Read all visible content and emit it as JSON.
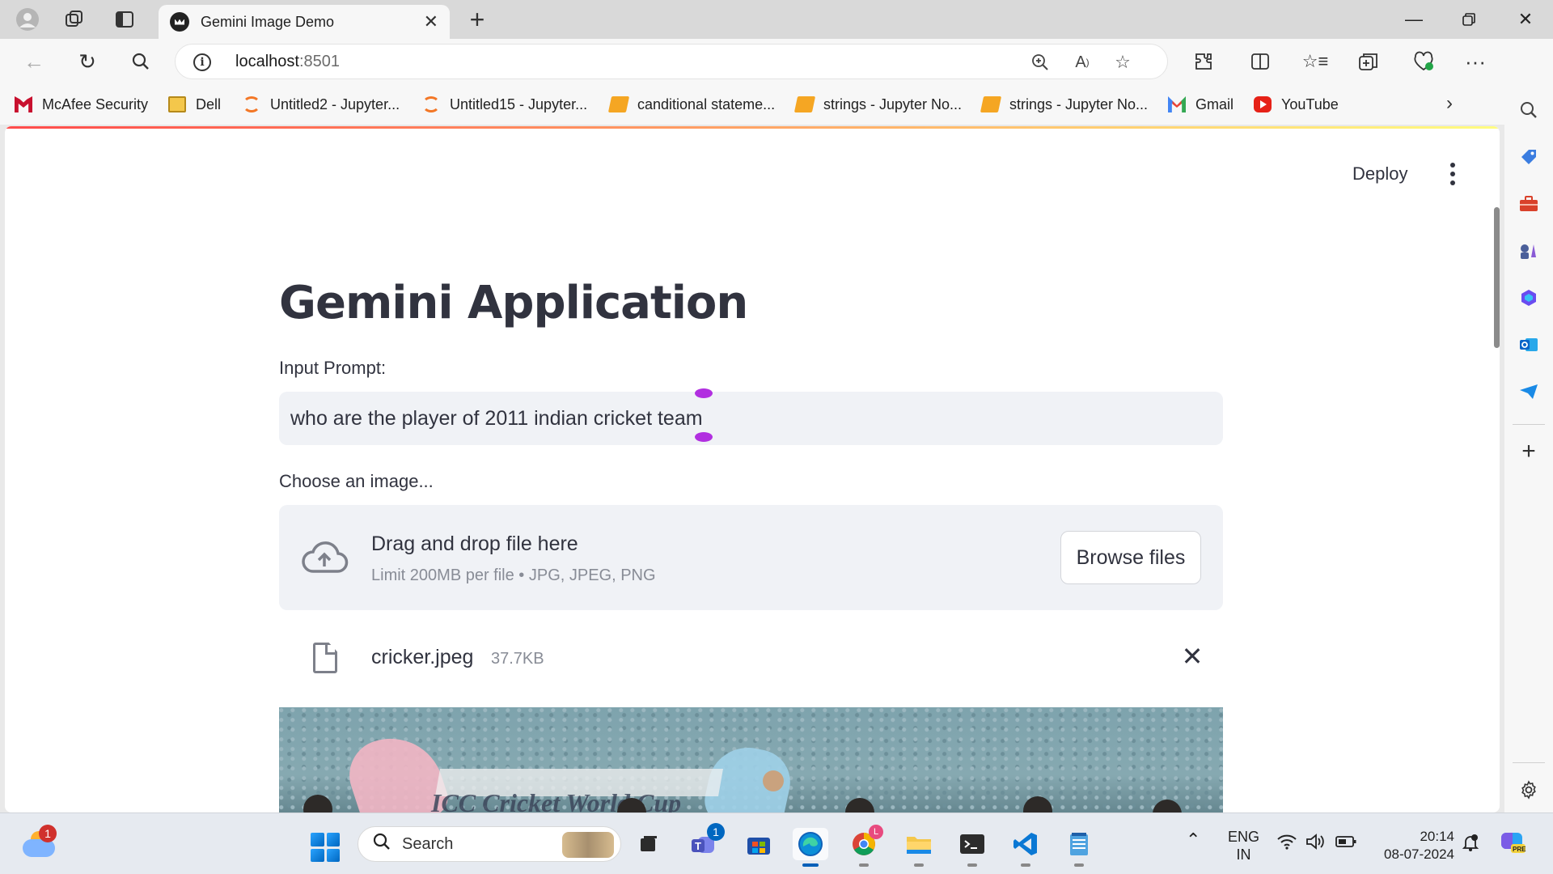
{
  "browser": {
    "tab_title": "Gemini Image Demo",
    "url_host": "localhost",
    "url_port": ":8501"
  },
  "bookmarks": [
    {
      "label": "McAfee Security",
      "icon": "mcafee-icon"
    },
    {
      "label": "Dell",
      "icon": "folder-icon"
    },
    {
      "label": "Untitled2 - Jupyter...",
      "icon": "jupyter-icon"
    },
    {
      "label": "Untitled15 - Jupyter...",
      "icon": "jupyter-icon"
    },
    {
      "label": "canditional stateme...",
      "icon": "notebook-icon"
    },
    {
      "label": "strings - Jupyter No...",
      "icon": "notebook-icon"
    },
    {
      "label": "strings - Jupyter No...",
      "icon": "notebook-icon"
    },
    {
      "label": "Gmail",
      "icon": "gmail-icon"
    },
    {
      "label": "YouTube",
      "icon": "youtube-icon"
    }
  ],
  "app": {
    "deploy_label": "Deploy",
    "title": "Gemini Application",
    "prompt_label": "Input Prompt:",
    "prompt_value": "who are the player of 2011 indian cricket team",
    "image_label": "Choose an image...",
    "dropzone_title": "Drag and drop file here",
    "dropzone_limit": "Limit 200MB per file • JPG, JPEG, PNG",
    "browse_label": "Browse files",
    "file_name": "cricker.jpeg",
    "file_size": "37.7KB",
    "preview_caption_text": "ICC Cricket World Cup"
  },
  "taskbar": {
    "weather_badge": "1",
    "search_label": "Search",
    "teams_badge": "1",
    "lang_top": "ENG",
    "lang_bottom": "IN",
    "time": "20:14",
    "date": "08-07-2024"
  },
  "colors": {
    "streamlit_accent": "#ff4b4b",
    "text_primary": "#31333f",
    "input_bg": "#f0f2f6",
    "selection_handle": "#b12fe0"
  }
}
